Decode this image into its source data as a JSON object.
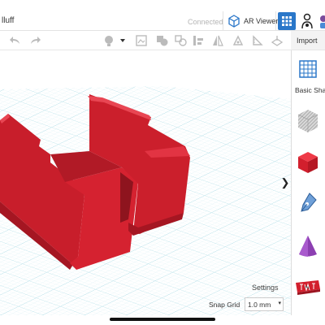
{
  "header": {
    "project_name": "lluff",
    "status": "Connected",
    "ar_viewer_label": "AR Viewer"
  },
  "toolbar": {
    "import_label": "Import"
  },
  "panel": {
    "category_label": "Basic Shap",
    "items": [
      {
        "name": "workplane-shape",
        "icon": "grid-plane-icon"
      },
      {
        "name": "striped-box",
        "icon": "striped-cube-icon"
      },
      {
        "name": "box",
        "icon": "red-cube-icon"
      },
      {
        "name": "scribble",
        "icon": "pen-nib-icon"
      },
      {
        "name": "cone",
        "icon": "purple-cone-icon"
      },
      {
        "name": "text",
        "icon": "red-text-icon"
      }
    ]
  },
  "workplane": {
    "settings_label": "Settings",
    "snap_grid_label": "Snap Grid",
    "snap_grid_value": "1.0 mm"
  },
  "colors": {
    "accent": "#2a77c9",
    "shape_red": "#d21f2d",
    "grid_line": "#bfe3ea"
  }
}
